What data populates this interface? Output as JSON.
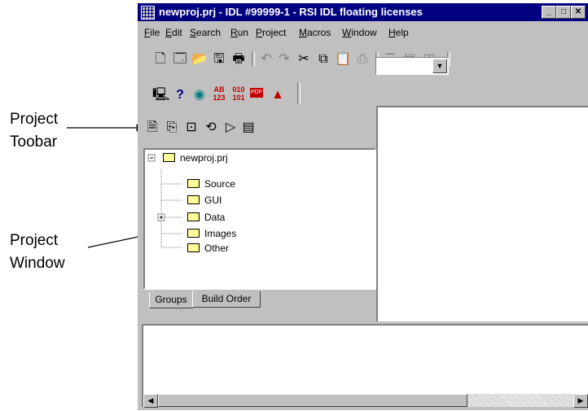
{
  "callouts": {
    "toolbar_label": [
      "Project",
      "Toobar"
    ],
    "window_label": [
      "Project",
      "Window"
    ]
  },
  "window": {
    "title": "newproj.prj - IDL #99999-1 - RSI IDL floating licenses",
    "controls": [
      "minimize",
      "maximize",
      "close"
    ]
  },
  "menu": [
    "File",
    "Edit",
    "Search",
    "Run",
    "Project",
    "Macros",
    "Window",
    "Help"
  ],
  "toolbar_icons": [
    "new-file-icon",
    "new-window-icon",
    "open-icon",
    "save-icon",
    "print-icon",
    "undo-icon",
    "redo-icon",
    "cut-icon",
    "copy-icon",
    "paste-icon",
    "print-preview-icon",
    "tile-icon",
    "cascade-icon",
    "columns-icon"
  ],
  "toolbar2_icons": [
    {
      "name": "monitor-icon",
      "glyph": "🖳"
    },
    {
      "name": "help-icon",
      "glyph": "?"
    },
    {
      "name": "eye-icon",
      "glyph": "👁"
    },
    {
      "name": "abc-123-icon",
      "glyph": "AB"
    },
    {
      "name": "binary-icon",
      "glyph": "01"
    },
    {
      "name": "pdf-icon",
      "glyph": "PDF"
    },
    {
      "name": "map-icon",
      "glyph": "▲"
    }
  ],
  "project_toolbar_icons": [
    "project-new-icon",
    "project-add-icon",
    "project-view-icon",
    "project-compile-icon",
    "project-run-icon",
    "project-properties-icon"
  ],
  "tree": {
    "root": "newproj.prj",
    "children": [
      "Source",
      "GUI",
      "Data",
      "Images",
      "Other"
    ]
  },
  "tabs": [
    "Groups",
    "Build Order"
  ]
}
